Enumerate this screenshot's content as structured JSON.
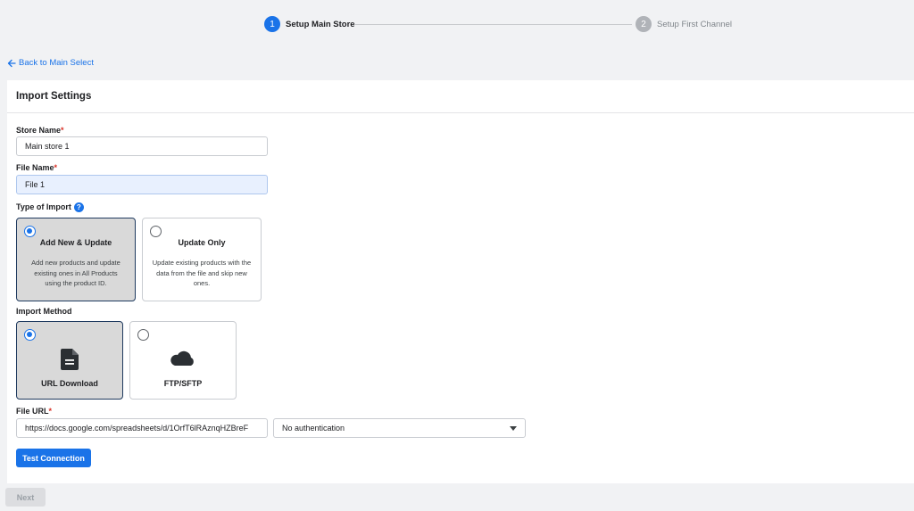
{
  "stepper": {
    "steps": [
      {
        "number": "1",
        "label": "Setup Main Store",
        "state": "active"
      },
      {
        "number": "2",
        "label": "Setup First Channel",
        "state": "inactive"
      }
    ]
  },
  "nav": {
    "back_label": "Back to Main Select"
  },
  "panel": {
    "title": "Import Settings"
  },
  "store_name": {
    "label": "Store Name",
    "required_mark": "*",
    "value": "Main store 1"
  },
  "file_name": {
    "label": "File Name",
    "required_mark": "*",
    "value": "File 1"
  },
  "type_of_import": {
    "label": "Type of Import",
    "help_icon": "?",
    "options": [
      {
        "title": "Add New & Update",
        "description": "Add new products and update existing ones in All Products using the product ID.",
        "selected": true
      },
      {
        "title": "Update Only",
        "description": "Update existing products with the data from the file and skip new ones.",
        "selected": false
      }
    ]
  },
  "import_method": {
    "label": "Import Method",
    "options": [
      {
        "title": "URL Download",
        "icon": "document-icon",
        "selected": true
      },
      {
        "title": "FTP/SFTP",
        "icon": "cloud-icon",
        "selected": false
      }
    ]
  },
  "file_url": {
    "label": "File URL",
    "required_mark": "*",
    "value": "https://docs.google.com/spreadsheets/d/1OrfT6lRAznqHZBreF",
    "auth_selected": "No authentication"
  },
  "buttons": {
    "test_connection": "Test Connection",
    "next": "Next"
  },
  "colors": {
    "accent": "#1a73e8",
    "required": "#d93025",
    "selected_card_bg": "#d9d9d9"
  }
}
